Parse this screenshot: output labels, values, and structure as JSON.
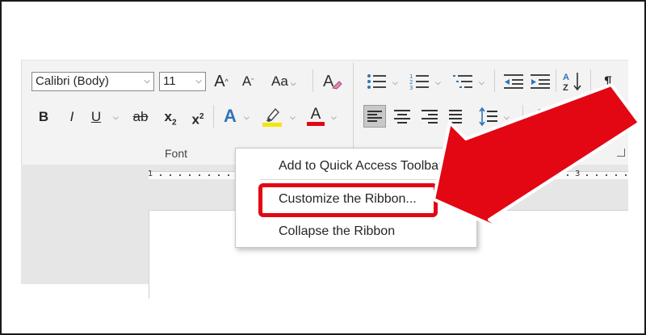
{
  "ribbon": {
    "font_name": "Calibri (Body)",
    "font_size": "11",
    "grow_font": "A",
    "shrink_font": "A",
    "change_case": "Aa",
    "bold": "B",
    "italic": "I",
    "underline": "U",
    "strikethrough": "ab",
    "subscript": "x",
    "subscript_suffix": "2",
    "superscript": "x",
    "superscript_suffix": "2",
    "text_effects": "A",
    "font_color": "A",
    "paragraph_mark": "¶",
    "group_label": "Font",
    "colors": {
      "highlight": "#f5e600",
      "font_color": "#e30613",
      "text_effects": "#2e75b6",
      "accent": "#e30613"
    }
  },
  "ruler": {
    "label_1": "1",
    "label_3": "3"
  },
  "context_menu": {
    "items": [
      {
        "label": "Add to Quick Access Toolbar"
      },
      {
        "label": "Customize the Ribbon..."
      },
      {
        "label": "Collapse the Ribbon"
      }
    ]
  }
}
